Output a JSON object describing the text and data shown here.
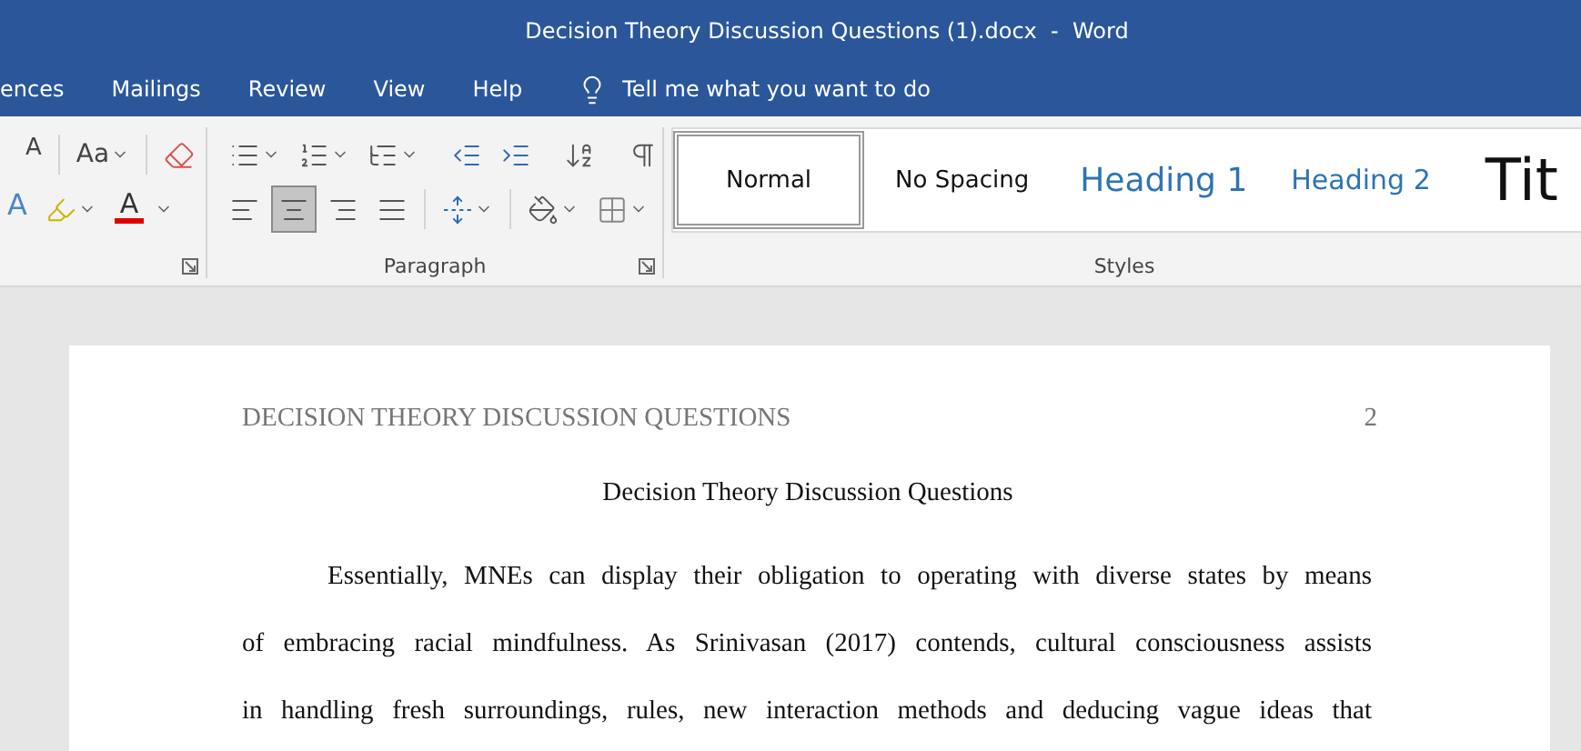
{
  "window": {
    "title": "Decision Theory Discussion Questions (1).docx  -  Word"
  },
  "tabs": [
    {
      "label": "ences",
      "selected": false
    },
    {
      "label": "Mailings",
      "selected": false
    },
    {
      "label": "Review",
      "selected": false
    },
    {
      "label": "View",
      "selected": false
    },
    {
      "label": "Help",
      "selected": false
    }
  ],
  "tell_me": {
    "placeholder": "Tell me what you want to do"
  },
  "font_group": {
    "shrink_label": "A",
    "case_label": "Aa",
    "effects_label": "A",
    "color_label": "A"
  },
  "paragraph_group": {
    "label": "Paragraph",
    "alignments": [
      {
        "kind": "left",
        "selected": false
      },
      {
        "kind": "center",
        "selected": true
      },
      {
        "kind": "right",
        "selected": false
      },
      {
        "kind": "justify",
        "selected": false
      }
    ]
  },
  "styles_group": {
    "label": "Styles",
    "items": [
      {
        "kind": "normal",
        "label": "Normal",
        "selected": true
      },
      {
        "kind": "nospacing",
        "label": "No Spacing",
        "selected": false
      },
      {
        "kind": "heading1",
        "label": "Heading 1",
        "selected": false
      },
      {
        "kind": "heading2",
        "label": "Heading 2",
        "selected": false
      },
      {
        "kind": "title",
        "label": "Tit",
        "selected": false
      }
    ]
  },
  "document": {
    "header": "DECISION THEORY DISCUSSION QUESTIONS",
    "page_number": "2",
    "title": "Decision Theory Discussion Questions",
    "lines": [
      {
        "text": "Essentially, MNEs can display their obligation to operating with diverse states by means",
        "indent": true
      },
      {
        "text": "of embracing racial mindfulness. As Srinivasan (2017) contends, cultural consciousness assists",
        "indent": false
      },
      {
        "text": "in handling fresh surroundings, rules, new interaction methods and deducing vague ideas that",
        "indent": false
      }
    ]
  }
}
